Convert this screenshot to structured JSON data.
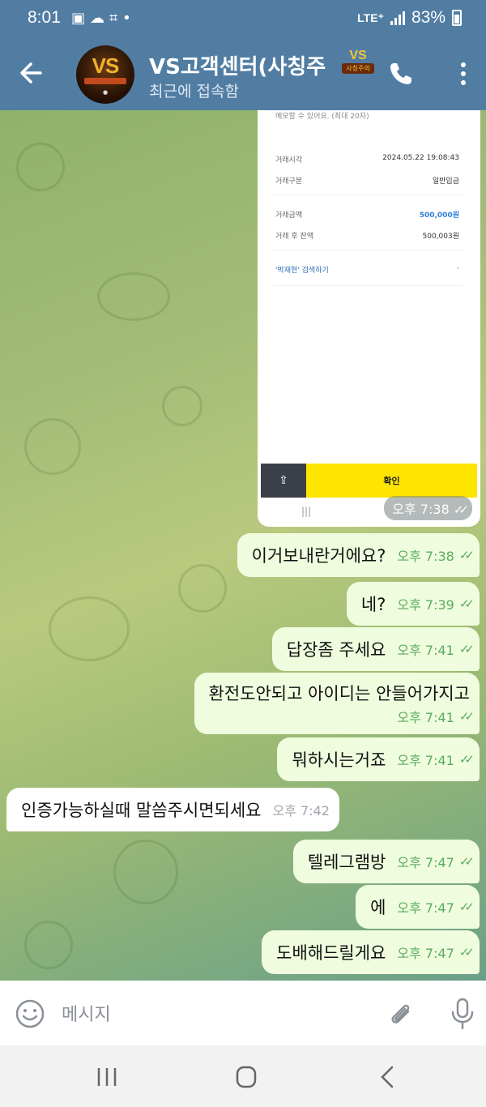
{
  "status_bar": {
    "time": "8:01",
    "network": "LTE⁺",
    "battery": "83%"
  },
  "header": {
    "title": "VS고객센터(사칭주",
    "subtitle": "최근에 접속함",
    "avatar_text": "VS",
    "badge_top": "VS",
    "badge_bottom": "사칭주의"
  },
  "screenshot_message": {
    "hint": "메모할 수 있어요. (최대 20자)",
    "rows": [
      {
        "label": "거래시각",
        "value": "2024.05.22 19:08:43"
      },
      {
        "label": "거래구분",
        "value": "일반입금"
      },
      {
        "label": "거래금액",
        "value": "500,000원"
      },
      {
        "label": "거래 후 잔액",
        "value": "500,003원"
      }
    ],
    "search_label": "'박재현' 검색하기",
    "confirm_label": "확인",
    "time": "오후 7:38"
  },
  "messages": [
    {
      "dir": "out",
      "text": "이거보내란거에요?",
      "time": "오후 7:38"
    },
    {
      "dir": "out",
      "text": "네?",
      "time": "오후 7:39"
    },
    {
      "dir": "out",
      "text": "답장좀 주세요",
      "time": "오후 7:41"
    },
    {
      "dir": "out",
      "text": "환전도안되고 아이디는 안들어가지고",
      "time": "오후 7:41"
    },
    {
      "dir": "out",
      "text": "뭐하시는거죠",
      "time": "오후 7:41"
    },
    {
      "dir": "in",
      "text": "인증가능하실때 말씀주시면되세요",
      "time": "오후 7:42"
    },
    {
      "dir": "out",
      "text": "텔레그램방",
      "time": "오후 7:47"
    },
    {
      "dir": "out",
      "text": "에",
      "time": "오후 7:47"
    },
    {
      "dir": "out",
      "text": "도배해드릴게요",
      "time": "오후 7:47"
    }
  ],
  "input": {
    "placeholder": "메시지"
  },
  "colors": {
    "header": "#527da3",
    "outgoing_bubble": "#effdde",
    "incoming_bubble": "#ffffff",
    "check_green": "#5aab5f"
  }
}
